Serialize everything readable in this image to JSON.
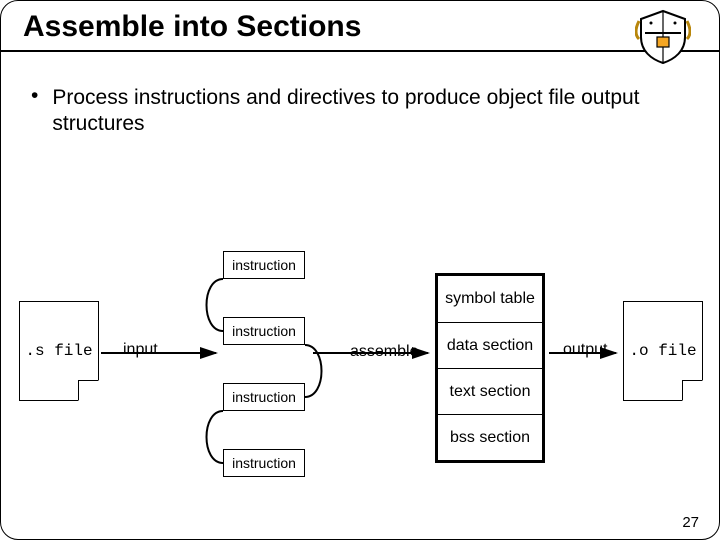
{
  "title": "Assemble into Sections",
  "bullet": "Process instructions and directives to produce object file output structures",
  "file_left": ".s file",
  "file_right": ".o file",
  "labels": {
    "input": "input",
    "assemble": "assemble",
    "output": "output"
  },
  "instructions": {
    "i1": "instruction",
    "i2": "instruction",
    "i3": "instruction",
    "i4": "instruction"
  },
  "sections": {
    "s1": "symbol table",
    "s2": "data section",
    "s3": "text section",
    "s4": "bss section"
  },
  "page": "27"
}
